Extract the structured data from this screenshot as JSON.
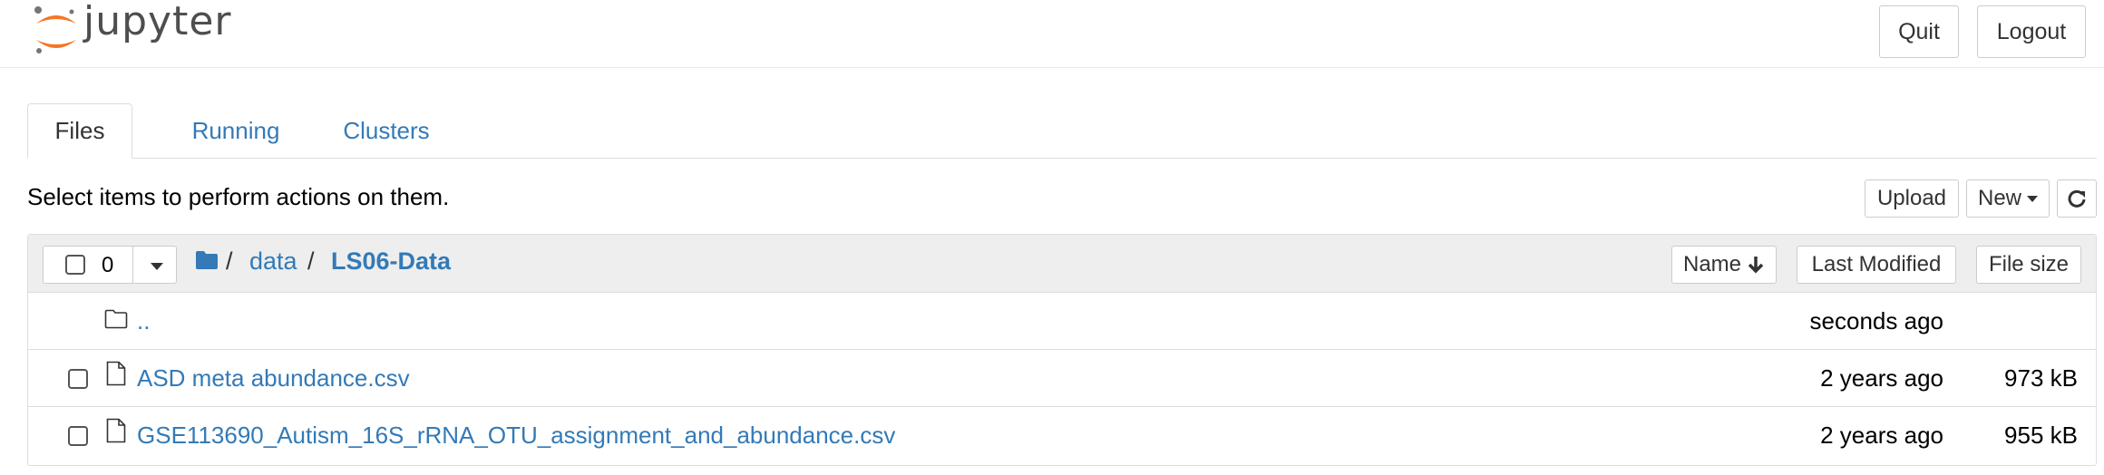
{
  "header": {
    "logo_text": "jupyter",
    "quit_label": "Quit",
    "logout_label": "Logout"
  },
  "tabs": [
    {
      "label": "Files",
      "active": true
    },
    {
      "label": "Running",
      "active": false
    },
    {
      "label": "Clusters",
      "active": false
    }
  ],
  "toolbar": {
    "hint": "Select items to perform actions on them.",
    "upload_label": "Upload",
    "new_label": "New"
  },
  "list": {
    "selected_count": "0",
    "breadcrumb": [
      {
        "label": "data"
      },
      {
        "label": "LS06-Data"
      }
    ],
    "sort_name_label": "Name",
    "sort_modified_label": "Last Modified",
    "sort_size_label": "File size",
    "rows": [
      {
        "name": "..",
        "modified": "seconds ago",
        "size": "",
        "icon": "folder-icon"
      },
      {
        "name": "ASD meta abundance.csv",
        "modified": "2 years ago",
        "size": "973 kB",
        "icon": "file-icon"
      },
      {
        "name": "GSE113690_Autism_16S_rRNA_OTU_assignment_and_abundance.csv",
        "modified": "2 years ago",
        "size": "955 kB",
        "icon": "file-icon"
      }
    ]
  },
  "colors": {
    "link": "#337ab7",
    "logo_orange": "#f37726",
    "header_gray": "#eeeeee"
  }
}
